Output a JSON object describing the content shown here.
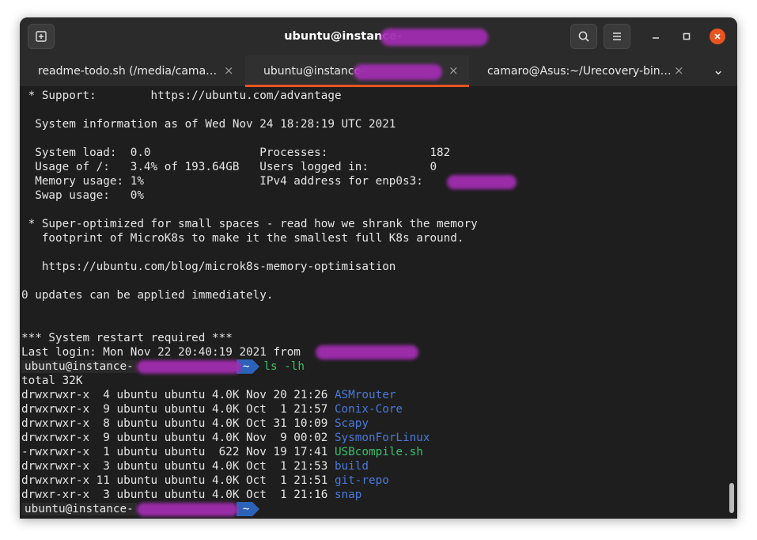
{
  "window": {
    "title": "ubuntu@instance-",
    "colors": {
      "accent": "#e95420",
      "bg": "#1e1e1e",
      "blue": "#4a79d8",
      "green": "#35c06a",
      "redaction": "#a12db0"
    }
  },
  "titlebar": {
    "new_tab_icon": "new-tab-icon",
    "search_icon": "search-icon",
    "menu_icon": "hamburger-menu-icon",
    "minimize_icon": "minimize-icon",
    "maximize_icon": "maximize-icon",
    "close_icon": "close-icon"
  },
  "tabs": [
    {
      "label": "readme-todo.sh (/media/cama…",
      "close": "×"
    },
    {
      "label": "ubuntu@instance-",
      "close": "×"
    },
    {
      "label": "camaro@Asus:~/Urecovery-bin…",
      "close": "×"
    },
    {
      "label": "⌄"
    }
  ],
  "terminal": {
    "l01": " * Support:        https://ubuntu.com/advantage",
    "l02": "  System information as of Wed Nov 24 18:28:19 UTC 2021",
    "l03": "  System load:  0.0                Processes:               182",
    "l04": "  Usage of /:   3.4% of 193.64GB   Users logged in:         0",
    "l05": "  Memory usage: 1%                 IPv4 address for enp0s3: ",
    "l06": "  Swap usage:   0%",
    "l07": " * Super-optimized for small spaces - read how we shrank the memory",
    "l08": "   footprint of MicroK8s to make it the smallest full K8s around.",
    "l09": "   https://ubuntu.com/blog/microk8s-memory-optimisation",
    "l10": "0 updates can be applied immediately.",
    "l11": "*** System restart required ***",
    "l12": "Last login: Mon Nov 22 20:40:19 2021 from ",
    "prompt1_user": "ubuntu@instance-",
    "prompt_dir": "~",
    "prompt1_cmd": "ls -lh",
    "total": "total 32K",
    "listing": [
      {
        "meta": "drwxrwxr-x  4 ubuntu ubuntu 4.0K Nov 20 21:26 ",
        "name": "ASMrouter",
        "kind": "dir"
      },
      {
        "meta": "drwxrwxr-x  9 ubuntu ubuntu 4.0K Oct  1 21:57 ",
        "name": "Conix-Core",
        "kind": "dir"
      },
      {
        "meta": "drwxrwxr-x  8 ubuntu ubuntu 4.0K Oct 31 10:09 ",
        "name": "Scapy",
        "kind": "dir"
      },
      {
        "meta": "drwxrwxr-x  9 ubuntu ubuntu 4.0K Nov  9 00:02 ",
        "name": "SysmonForLinux",
        "kind": "dir"
      },
      {
        "meta": "-rwxrwxr-x  1 ubuntu ubuntu  622 Nov 19 17:41 ",
        "name": "USBcompile.sh",
        "kind": "exec"
      },
      {
        "meta": "drwxrwxr-x  3 ubuntu ubuntu 4.0K Oct  1 21:53 ",
        "name": "build",
        "kind": "dir"
      },
      {
        "meta": "drwxrwxr-x 11 ubuntu ubuntu 4.0K Oct  1 21:51 ",
        "name": "git-repo",
        "kind": "dir"
      },
      {
        "meta": "drwxr-xr-x  3 ubuntu ubuntu 4.0K Oct  1 21:16 ",
        "name": "snap",
        "kind": "dir"
      }
    ],
    "prompt2_user": "ubuntu@instance-"
  }
}
